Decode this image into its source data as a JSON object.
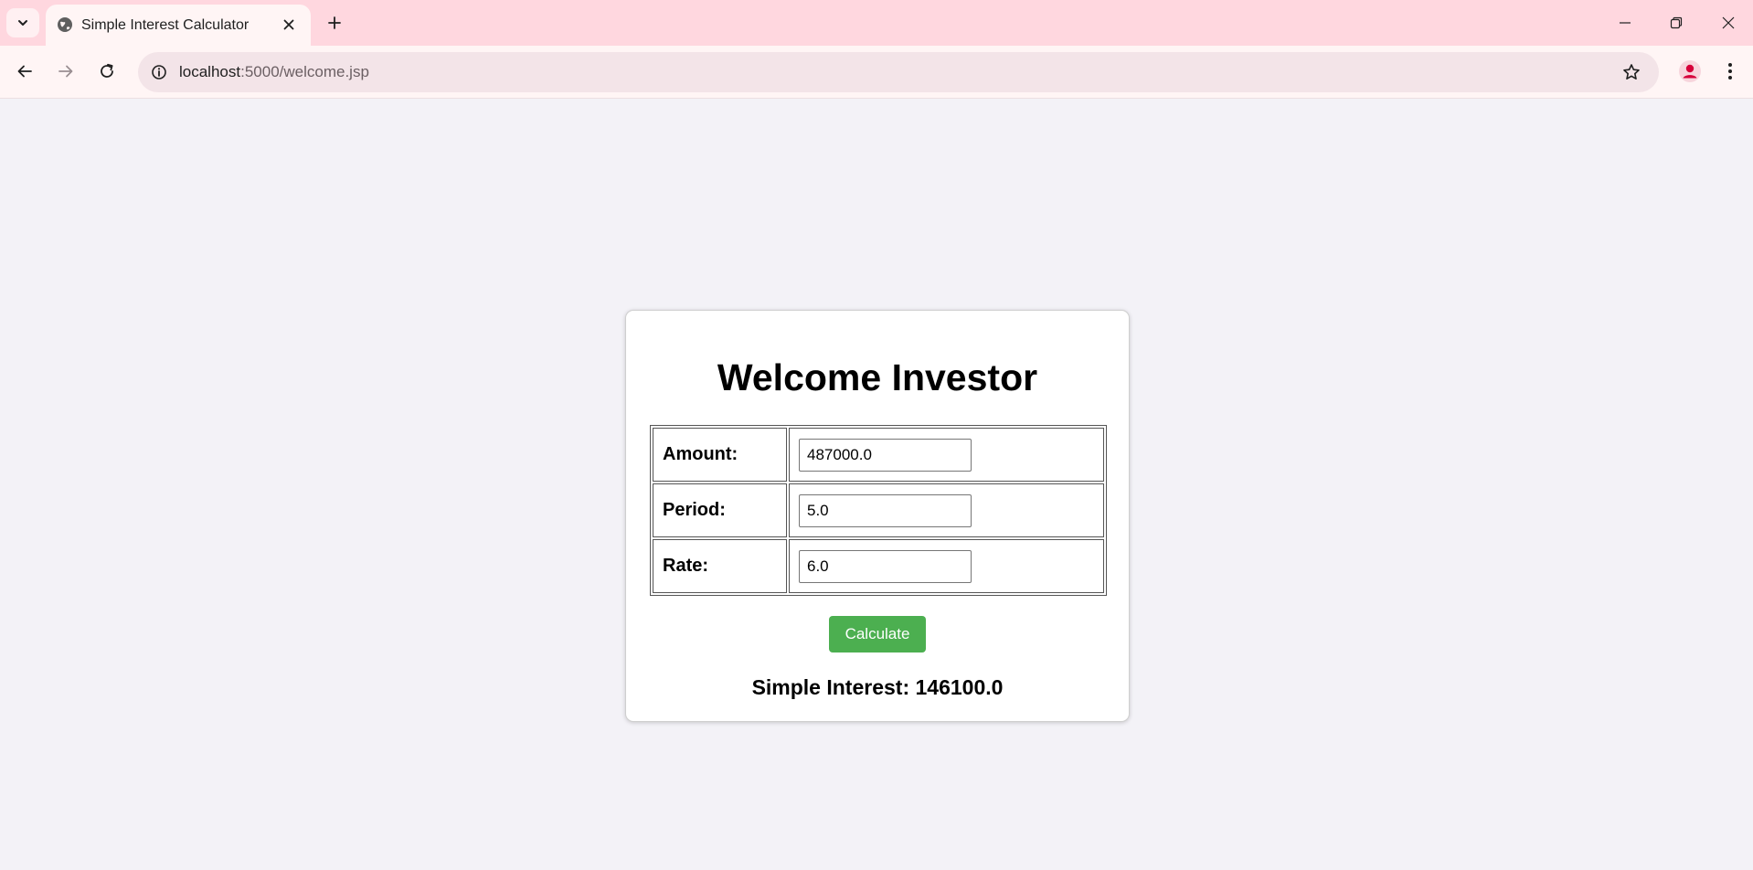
{
  "browser": {
    "tab_title": "Simple Interest Calculator",
    "url_host": "localhost",
    "url_path": ":5000/welcome.jsp"
  },
  "page": {
    "heading": "Welcome Investor",
    "fields": [
      {
        "label": "Amount:",
        "value": "487000.0"
      },
      {
        "label": "Period:",
        "value": "5.0"
      },
      {
        "label": "Rate:",
        "value": "6.0"
      }
    ],
    "calculate_label": "Calculate",
    "result_text": "Simple Interest: 146100.0"
  },
  "colors": {
    "button_green": "#4caf50",
    "profile_red": "#d6003a",
    "page_background": "#f3f2f7",
    "titlebar": "#ffd7df"
  }
}
